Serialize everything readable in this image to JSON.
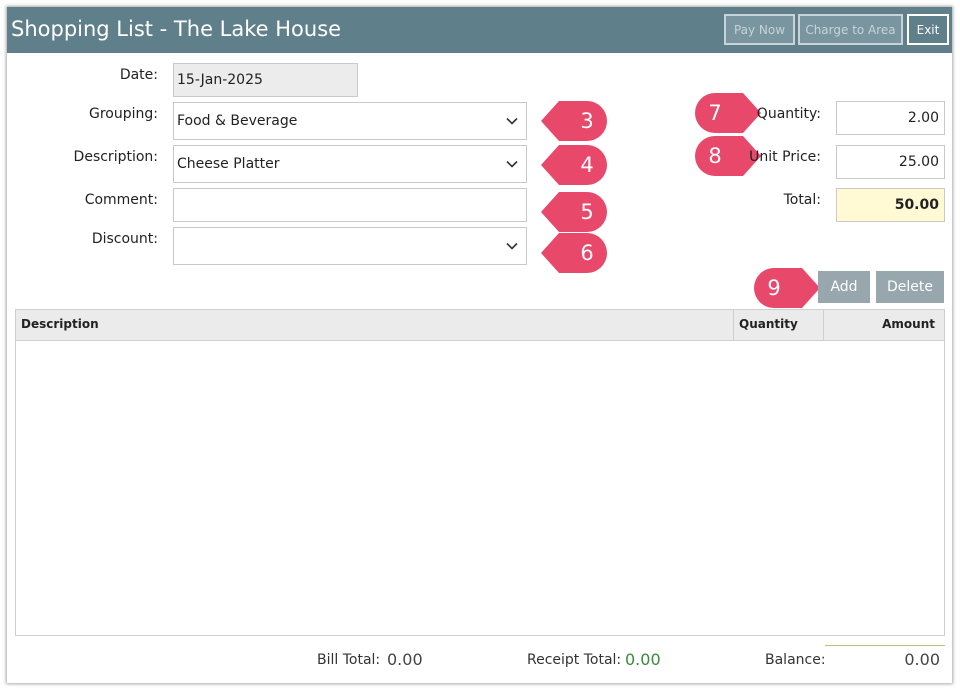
{
  "window": {
    "title": "Shopping List - The Lake House",
    "buttons": {
      "pay_now": "Pay Now",
      "charge_to_area": "Charge to Area",
      "exit": "Exit"
    }
  },
  "form": {
    "date": {
      "label": "Date:",
      "value": "15-Jan-2025"
    },
    "grouping": {
      "label": "Grouping:",
      "value": "Food & Beverage"
    },
    "description": {
      "label": "Description:",
      "value": "Cheese Platter"
    },
    "comment": {
      "label": "Comment:",
      "value": ""
    },
    "discount": {
      "label": "Discount:",
      "value": ""
    },
    "quantity": {
      "label": "Quantity:",
      "value": "2.00"
    },
    "unit_price": {
      "label": "Unit Price:",
      "value": "25.00"
    },
    "total": {
      "label": "Total:",
      "value": "50.00"
    }
  },
  "markers": {
    "m3": "3",
    "m4": "4",
    "m5": "5",
    "m6": "6",
    "m7": "7",
    "m8": "8",
    "m9": "9"
  },
  "marker_color": "#e8486a",
  "actions": {
    "add": "Add",
    "delete": "Delete"
  },
  "grid": {
    "columns": [
      "Description",
      "Quantity",
      "Amount"
    ],
    "rows": []
  },
  "footer": {
    "bill_total_label": "Bill Total:",
    "bill_total": "0.00",
    "receipt_total_label": "Receipt Total:",
    "receipt_total": "0.00",
    "balance_label": "Balance:",
    "balance": "0.00"
  },
  "icons": {
    "dropdown": "chevron-down-icon"
  }
}
